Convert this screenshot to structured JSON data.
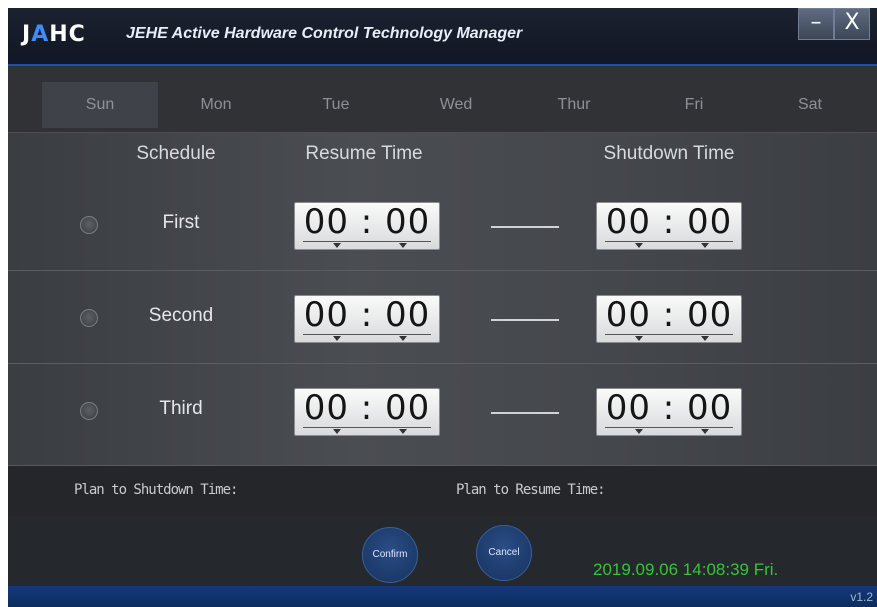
{
  "titlebar": {
    "logo_prefix": "J",
    "logo_accent": "A",
    "logo_suffix": "HC",
    "title": "JEHE Active Hardware Control Technology Manager",
    "minimize": "–",
    "close": "X"
  },
  "days": [
    {
      "label": "Sun",
      "active": true
    },
    {
      "label": "Mon",
      "active": false
    },
    {
      "label": "Tue",
      "active": false
    },
    {
      "label": "Wed",
      "active": false
    },
    {
      "label": "Thur",
      "active": false
    },
    {
      "label": "Fri",
      "active": false
    },
    {
      "label": "Sat",
      "active": false
    }
  ],
  "schedule": {
    "headers": {
      "schedule": "Schedule",
      "resume": "Resume Time",
      "shutdown": "Shutdown Time"
    },
    "rows": [
      {
        "label": "First",
        "resume": "00 : 00",
        "shutdown": "00 : 00"
      },
      {
        "label": "Second",
        "resume": "00 : 00",
        "shutdown": "00 : 00"
      },
      {
        "label": "Third",
        "resume": "00 : 00",
        "shutdown": "00 : 00"
      }
    ]
  },
  "info": {
    "plan_shutdown": "Plan to Shutdown Time:",
    "plan_resume": "Plan to Resume Time:"
  },
  "footer": {
    "confirm": "Confirm",
    "cancel": "Cancel",
    "datetime": "2019.09.06   14:08:39   Fri.",
    "version": "v1.2"
  },
  "colors": {
    "accent": "#1f4fa8",
    "datetime_green": "#35c535",
    "button_blue": "#16325e"
  }
}
